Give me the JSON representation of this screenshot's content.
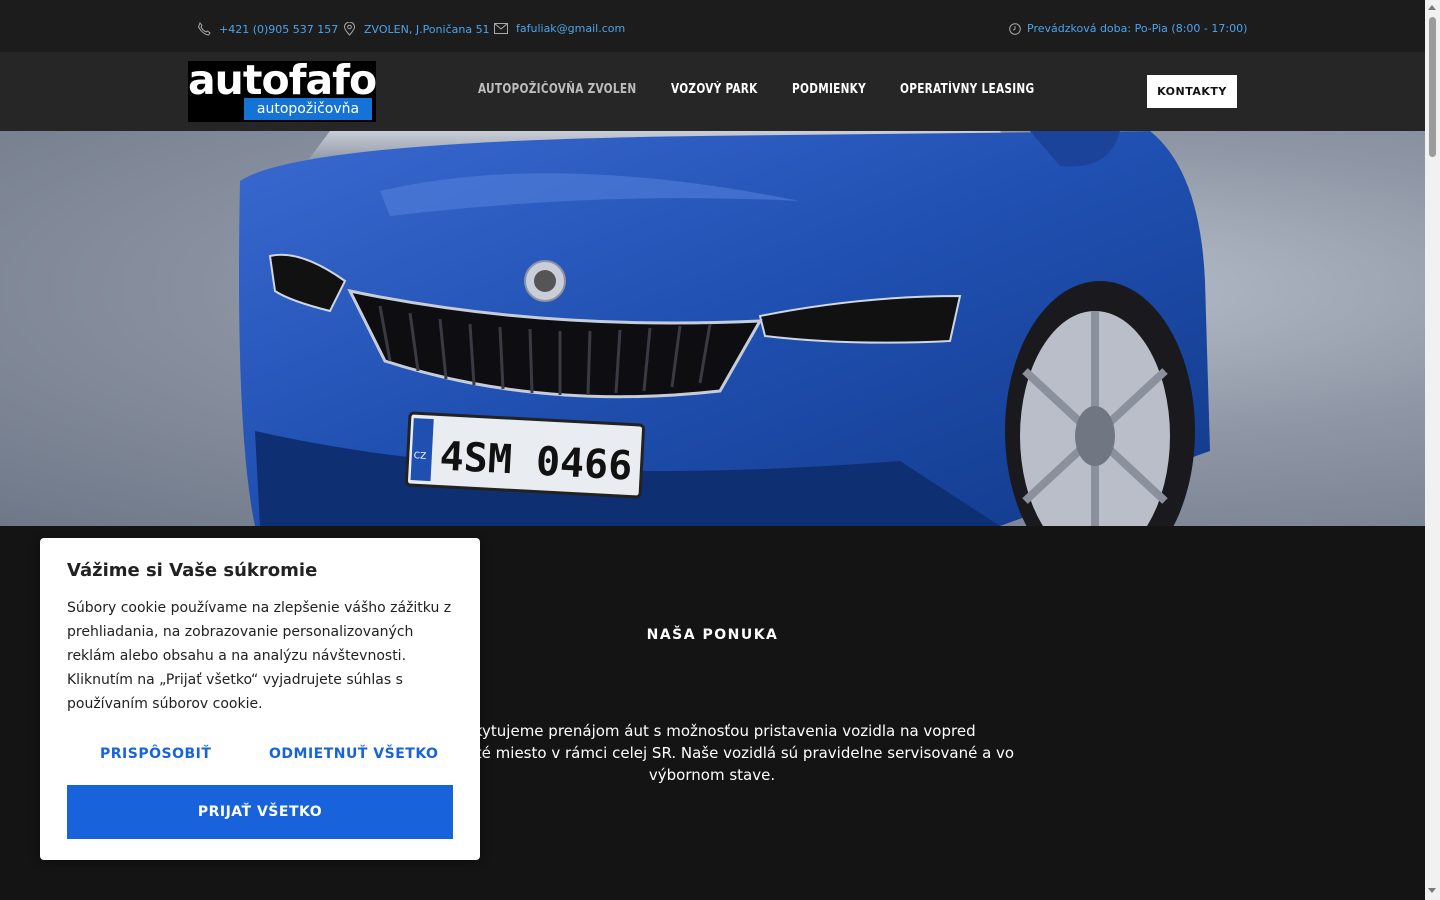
{
  "topbar": {
    "phone": "+421 (0)905 537 157",
    "address": "ZVOLEN, J.Poničana 51",
    "email": "fafuliak@gmail.com",
    "hours": "Prevádzková doba: Po-Pia (8:00 - 17:00)"
  },
  "logo": {
    "brand": "autofafo",
    "sub": "autopožičovňa"
  },
  "nav": {
    "items": [
      "AUTOPOŽIČOVŇA ZVOLEN",
      "VOZOVÝ PARK",
      "PODMIENKY",
      "OPERATÍVNY LEASING"
    ],
    "cta": "KONTAKTY"
  },
  "hero": {
    "plate": "4SM 0466",
    "plate_country": "CZ"
  },
  "offer": {
    "title": "NAŠA PONUKA",
    "text": "Poskytujeme prenájom áut s možnosťou pristavenia vozidla na vopred dohodnuté miesto v rámci celej SR. Naše vozidlá sú pravidelne servisované a vo výbornom stave."
  },
  "cookie": {
    "title": "Vážime si Vaše súkromie",
    "body": "Súbory cookie používame na zlepšenie vášho zážitku z prehliadania, na zobrazovanie personalizovaných reklám alebo obsahu a na analýzu návštevnosti. Kliknutím na „Prijať všetko“ vyjadrujete súhlas s používaním súborov cookie.",
    "customize": "PRISPÔSOBIŤ",
    "reject": "ODMIETNUŤ VŠETKO",
    "accept": "PRIJAŤ VŠETKO"
  },
  "colors": {
    "accent": "#1863dc",
    "link": "#4ea3ea",
    "car": "#1f4fb0"
  }
}
